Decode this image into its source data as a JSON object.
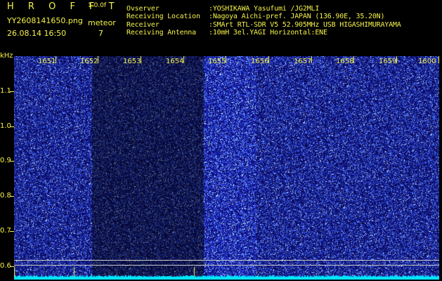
{
  "app": {
    "title": "H R O F F T",
    "version": "1.0.0f",
    "filename": "YY2608141650.png",
    "datetime": "26.08.14 16:50",
    "mode_label": "meteor",
    "count": "7"
  },
  "station": {
    "observer_label": "Ovserver",
    "observer_value": ":YOSHIKAWA Yasufumi /JG2MLI",
    "location_label": "Receiving Location",
    "location_value": ":Nagoya Aichi-pref. JAPAN (136.90E, 35.20N)",
    "receiver_label": "Receiver",
    "receiver_value": ":SMArt RTL-SDR V5 52.905MHz USB HIGASHIMURAYAMA",
    "antenna_label": "Receiving Antenna",
    "antenna_value": ":10mH 3el.YAGI Horizontal:ENE"
  },
  "axes": {
    "y_unit": "kHz",
    "y_ticks": [
      "1.1",
      "1.0",
      "0.9",
      "0.8",
      "0.7",
      "0.6"
    ],
    "x_ticks": [
      "1651",
      "1652",
      "1653",
      "1654",
      "1655",
      "1656",
      "1657",
      "1658",
      "1659",
      "1600"
    ]
  },
  "colors": {
    "text": "#f4f24a",
    "background": "#000000",
    "spectrogram_base": "#0a0a6a",
    "spectrogram_noise": "#3a5cff",
    "signal": "#00e5ff",
    "marker_line": "#c8c8c8"
  }
}
